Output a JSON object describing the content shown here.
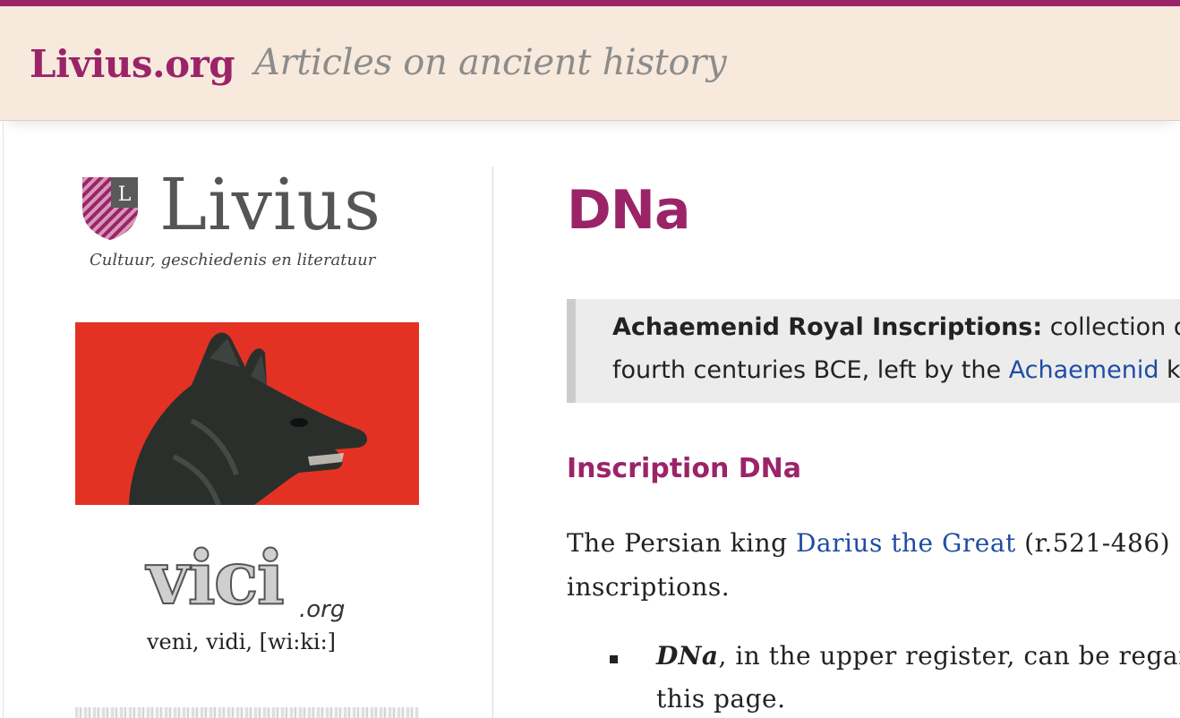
{
  "header": {
    "site_name": "Livius.org",
    "tagline": "Articles on ancient history"
  },
  "sidebar": {
    "livius_logo": {
      "word": "Livius",
      "shield_letter": "L",
      "subtitle": "Cultuur, geschiedenis en literatuur"
    },
    "vici_logo": {
      "word": "vici",
      "domain": ".org",
      "motto": "veni, vidi, [wi:ki:]"
    }
  },
  "main": {
    "title": "DNa",
    "intro": {
      "label": "Achaemenid Royal Inscriptions:",
      "line1_text": " collection of",
      "line2_text": "fourth centuries BCE, left by the ",
      "line2_link": "Achaemenid",
      "line2_tail": " k"
    },
    "section_heading": "Inscription DNa",
    "paragraph": {
      "line1_pre": "The Persian king ",
      "line1_link": "Darius the Great",
      "line1_post": " (r.521-486)",
      "line2": "inscriptions."
    },
    "bullet": {
      "term": "DNa",
      "line1_text": ", in the upper register, can be regar",
      "line2": "this page."
    }
  },
  "colors": {
    "accent": "#9b2469",
    "header_bg": "#f7eadc",
    "link": "#1f4da3",
    "wolf_bg": "#e33224"
  }
}
